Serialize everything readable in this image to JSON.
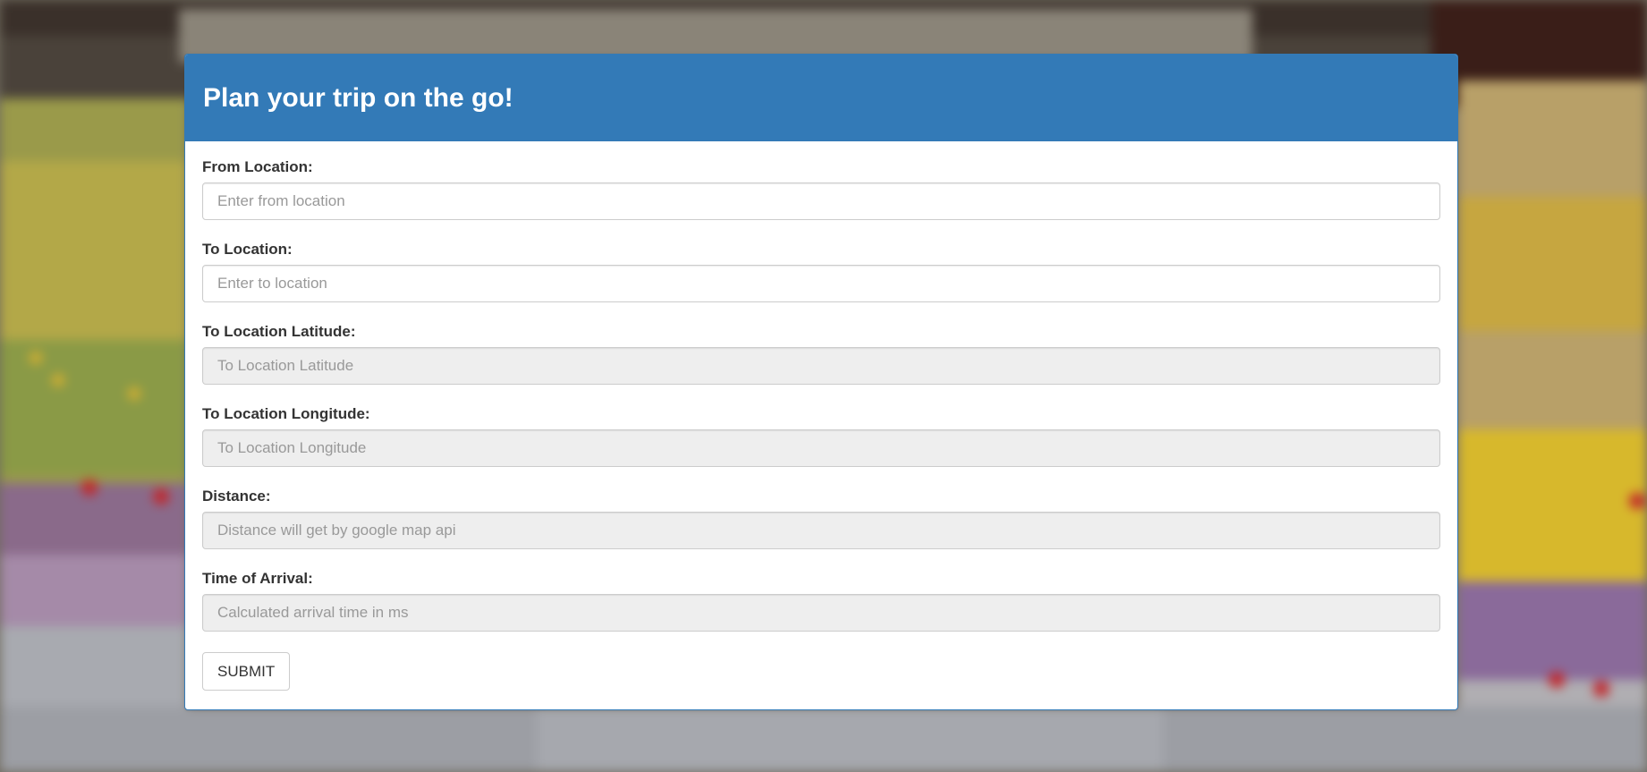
{
  "panel": {
    "title": "Plan your trip on the go!"
  },
  "form": {
    "from_location": {
      "label": "From Location:",
      "placeholder": "Enter from location",
      "value": ""
    },
    "to_location": {
      "label": "To Location:",
      "placeholder": "Enter to location",
      "value": ""
    },
    "to_latitude": {
      "label": "To Location Latitude:",
      "placeholder": "To Location Latitude",
      "value": ""
    },
    "to_longitude": {
      "label": "To Location Longitude:",
      "placeholder": "To Location Longitude",
      "value": ""
    },
    "distance": {
      "label": "Distance:",
      "placeholder": "Distance will get by google map api",
      "value": ""
    },
    "time_of_arrival": {
      "label": "Time of Arrival:",
      "placeholder": "Calculated arrival time in ms",
      "value": ""
    },
    "submit_label": "SUBMIT"
  },
  "colors": {
    "primary": "#337ab7",
    "readonly_bg": "#eeeeee",
    "label": "#333333"
  }
}
